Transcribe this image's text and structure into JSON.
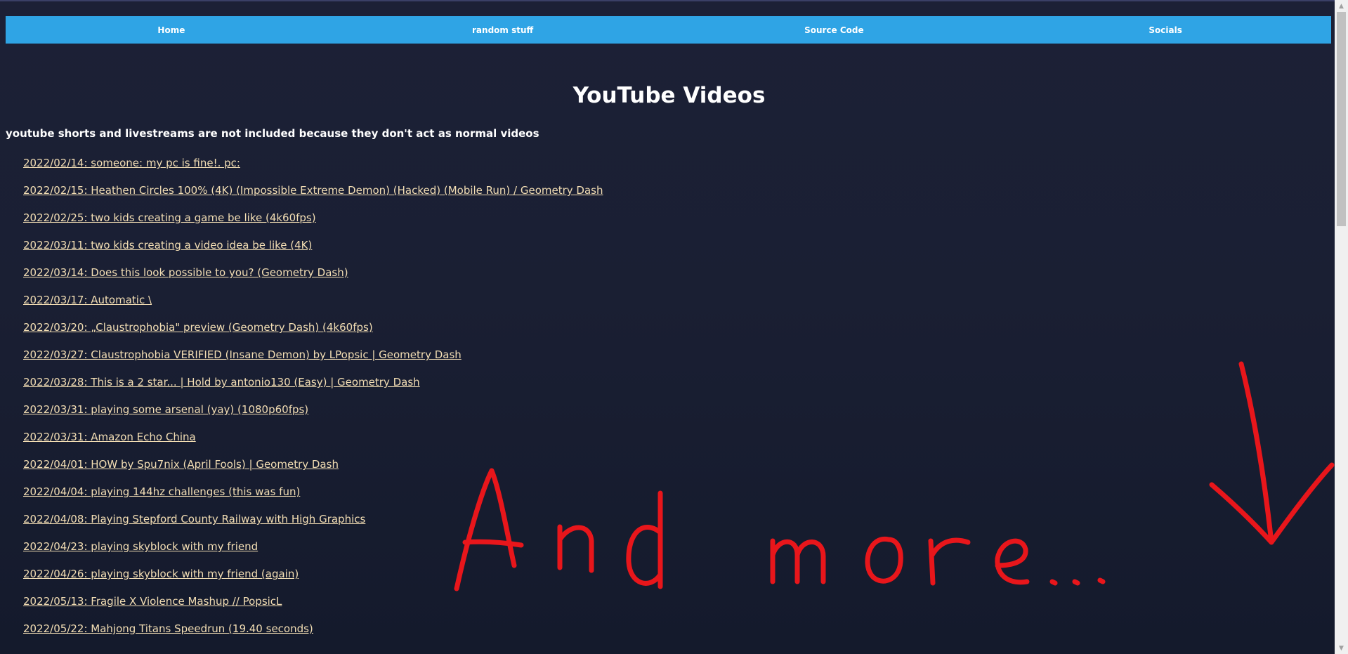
{
  "nav": {
    "items": [
      {
        "label": "Home"
      },
      {
        "label": "random stuff"
      },
      {
        "label": "Source Code"
      },
      {
        "label": "Socials"
      }
    ]
  },
  "main": {
    "title": "YouTube Videos",
    "note": "youtube shorts and livestreams are not included because they don't act as normal videos",
    "videos": [
      "2022/02/14: someone: my pc is fine!. pc:",
      "2022/02/15: Heathen Circles 100% (4K) (Impossible Extreme Demon) (Hacked) (Mobile Run) / Geometry Dash",
      "2022/02/25: two kids creating a game be like (4k60fps)",
      "2022/03/11: two kids creating a video idea be like (4K)",
      "2022/03/14: Does this look possible to you? (Geometry Dash)",
      "2022/03/17: Automatic \\",
      "2022/03/20: „Claustrophobia\" preview (Geometry Dash) (4k60fps)",
      "2022/03/27: Claustrophobia VERIFIED (Insane Demon) by LPopsic | Geometry Dash",
      "2022/03/28: This is a 2 star... | Hold by antonio130 (Easy) | Geometry Dash",
      "2022/03/31: playing some arsenal (yay) (1080p60fps)",
      "2022/03/31: Amazon Echo China",
      "2022/04/01: HOW by Spu7nix (April Fools) | Geometry Dash",
      "2022/04/04: playing 144hz challenges (this was fun)",
      "2022/04/08: Playing Stepford County Railway with High Graphics",
      "2022/04/23: playing skyblock with my friend",
      "2022/04/26: playing skyblock with my friend (again)",
      "2022/05/13: Fragile X Violence Mashup // PopsicL",
      "2022/05/22: Mahjong Titans Speedrun (19.40 seconds)"
    ]
  },
  "annotation": {
    "text": "And more...",
    "color": "#e8161b",
    "icon": "arrow-down-icon"
  },
  "scrollbar": {
    "up_icon": "scroll-up-icon",
    "down_icon": "scroll-down-icon"
  },
  "colors": {
    "nav_bg": "#2fa4e5",
    "link": "#f3deb4",
    "background": "#1a1f33"
  }
}
